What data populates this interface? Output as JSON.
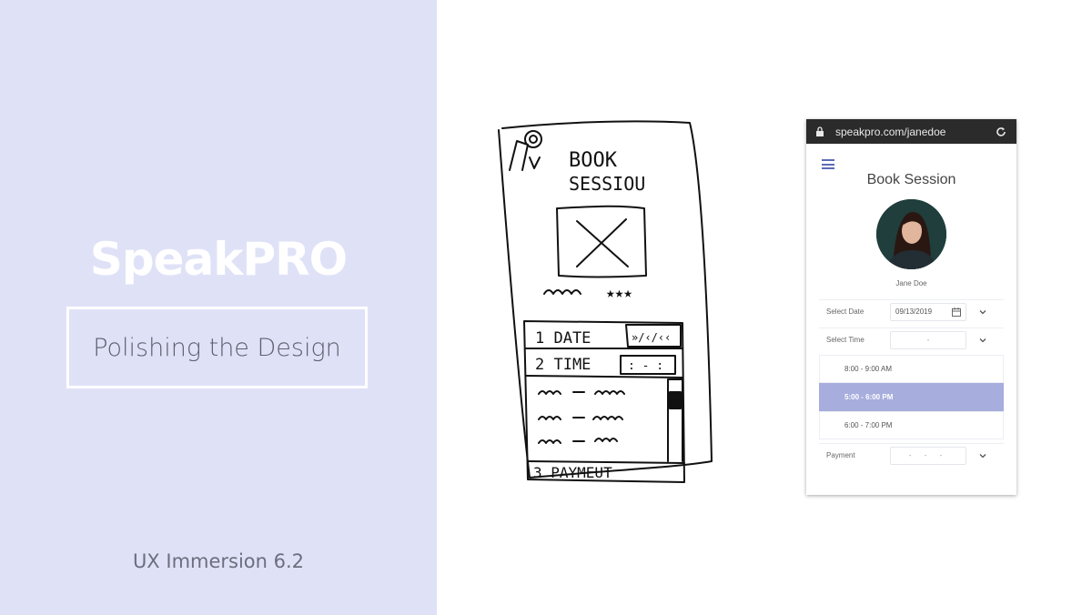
{
  "left": {
    "brand": "SpeakPRO",
    "subtitle": "Polishing the Design",
    "footer": "UX Immersion 6.2"
  },
  "sketch": {
    "title_line1": "BOOK",
    "title_line2": "SESSIOU",
    "row1": "1 DATE",
    "row1_field": "»/‹/‹‹",
    "row2": "2 TIME",
    "row2_field": ": - :",
    "row3": "3 PAYMEUT"
  },
  "mockup": {
    "url": "speakpro.com/janedoe",
    "title": "Book Session",
    "name": "Jane Doe",
    "date_label": "Select Date",
    "date_value": "09/13/2019",
    "time_label": "Select Time",
    "time_value": "-",
    "slots": [
      "8:00 - 9:00 AM",
      "5:00 - 6:00 PM",
      "6:00 - 7:00 PM"
    ],
    "selected_slot": 1,
    "payment_label": "Payment",
    "payment_value": "- - -",
    "accent_color": "#a7addd",
    "icons": [
      "lock-icon",
      "reload-icon",
      "hamburger-icon",
      "calendar-icon",
      "chevron-down-icon"
    ]
  }
}
